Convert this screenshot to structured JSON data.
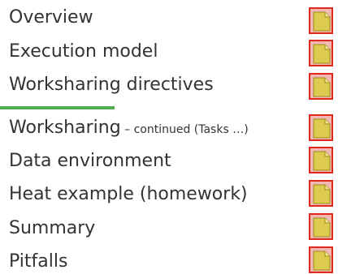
{
  "agenda": {
    "items": [
      {
        "label": "Overview",
        "note": ""
      },
      {
        "label": "Execution model",
        "note": ""
      },
      {
        "label": "Worksharing directives",
        "note": ""
      },
      {
        "label": "Worksharing",
        "note": " – continued (Tasks …)"
      },
      {
        "label": "Data environment",
        "note": ""
      },
      {
        "label": "Heat example (homework)",
        "note": ""
      },
      {
        "label": "Summary",
        "note": ""
      },
      {
        "label": "Pitfalls",
        "note": ""
      }
    ],
    "icon_name": "document-icon"
  },
  "colors": {
    "text": "#333333",
    "divider": "#4caf50",
    "icon_fill": "#dccb4e",
    "icon_border": "#e0281d"
  }
}
